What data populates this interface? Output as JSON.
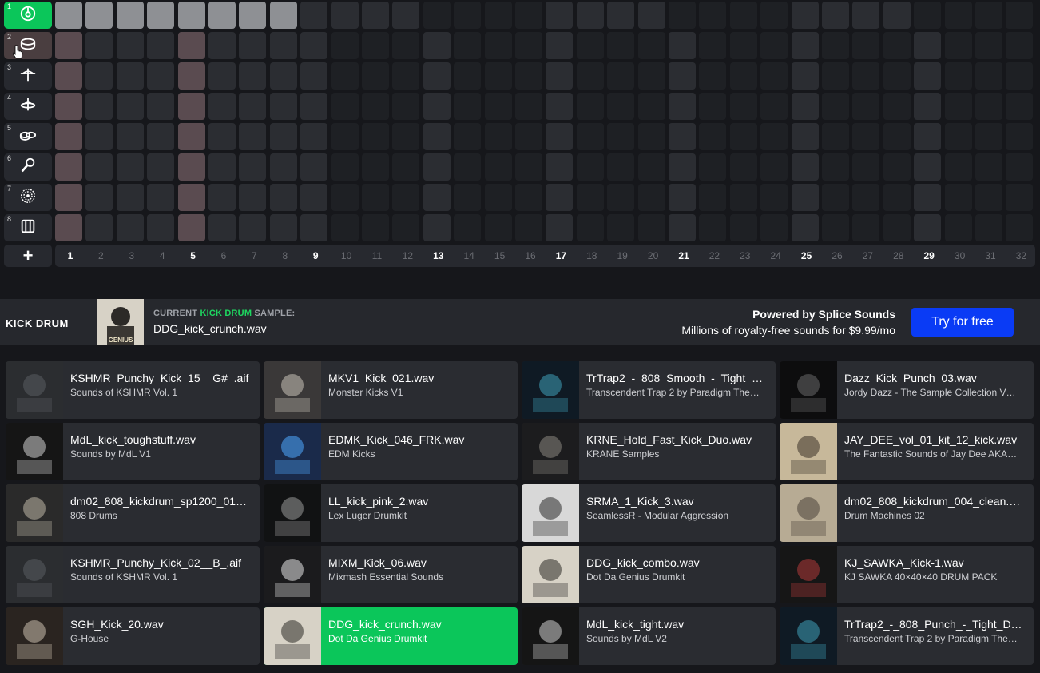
{
  "sequencer": {
    "rows": [
      {
        "num": "1",
        "icon": "kick-drum-icon"
      },
      {
        "num": "2",
        "icon": "snare-drum-icon"
      },
      {
        "num": "3",
        "icon": "hihat-closed-icon"
      },
      {
        "num": "4",
        "icon": "hihat-open-icon"
      },
      {
        "num": "5",
        "icon": "tom-icon"
      },
      {
        "num": "6",
        "icon": "shaker-icon"
      },
      {
        "num": "7",
        "icon": "ride-cymbal-icon"
      },
      {
        "num": "8",
        "icon": "clap-icon"
      }
    ],
    "add_row_label": "+",
    "steps": [
      "1",
      "2",
      "3",
      "4",
      "5",
      "6",
      "7",
      "8",
      "9",
      "10",
      "11",
      "12",
      "13",
      "14",
      "15",
      "16",
      "17",
      "18",
      "19",
      "20",
      "21",
      "22",
      "23",
      "24",
      "25",
      "26",
      "27",
      "28",
      "29",
      "30",
      "31",
      "32"
    ],
    "active_row": 1,
    "hover_row": 2,
    "lit_steps_row1": [
      1,
      2,
      3,
      4,
      5,
      6,
      7,
      8
    ]
  },
  "sample_header": {
    "instrument": "KICK DRUM",
    "label_prefix": "CURRENT ",
    "label_highlight": "KICK DRUM",
    "label_suffix": " SAMPLE:",
    "current_file": "DDG_kick_crunch.wav",
    "splice_title": "Powered by Splice Sounds",
    "splice_sub": "Millions of royalty-free sounds for $9.99/mo",
    "cta_label": "Try for free"
  },
  "samples": [
    {
      "file": "KSHMR_Punchy_Kick_15__G#_.aif",
      "pack": "Sounds of KSHMR Vol. 1",
      "color": "#2b2d30",
      "accent": "#5a5d62"
    },
    {
      "file": "MKV1_Kick_021.wav",
      "pack": "Monster Kicks V1",
      "color": "#3a3838",
      "accent": "#c9c2b8"
    },
    {
      "file": "TrTrap2_-_808_Smooth_-_Tight_…",
      "pack": "Transcendent Trap 2 by Paradigm The…",
      "color": "#0f1a24",
      "accent": "#3fa0b8"
    },
    {
      "file": "Dazz_Kick_Punch_03.wav",
      "pack": "Jordy Dazz - The Sample Collection V…",
      "color": "#0d0d0e",
      "accent": "#6a6a6a"
    },
    {
      "file": "MdL_kick_toughstuff.wav",
      "pack": "Sounds by MdL V1",
      "color": "#151515",
      "accent": "#d0d0d0"
    },
    {
      "file": "EDMK_Kick_046_FRK.wav",
      "pack": "EDM Kicks",
      "color": "#1a2a4a",
      "accent": "#4fa8ff"
    },
    {
      "file": "KRNE_Hold_Fast_Kick_Duo.wav",
      "pack": "KRANE Samples",
      "color": "#1c1c1e",
      "accent": "#8a8680"
    },
    {
      "file": "JAY_DEE_vol_01_kit_12_kick.wav",
      "pack": "The Fantastic Sounds of Jay Dee AKA…",
      "color": "#c7b89a",
      "accent": "#3a3128"
    },
    {
      "file": "dm02_808_kickdrum_sp1200_01…",
      "pack": "808 Drums",
      "color": "#2a2a2a",
      "accent": "#bdb6a6"
    },
    {
      "file": "LL_kick_pink_2.wav",
      "pack": "Lex Luger Drumkit",
      "color": "#111213",
      "accent": "#9a9a9a"
    },
    {
      "file": "SRMA_1_Kick_3.wav",
      "pack": "SeamlessR - Modular Aggression",
      "color": "#d8d8d8",
      "accent": "#2a2a2a"
    },
    {
      "file": "dm02_808_kickdrum_004_clean.…",
      "pack": "Drum Machines 02",
      "color": "#b7ab94",
      "accent": "#4b4238"
    },
    {
      "file": "KSHMR_Punchy_Kick_02__B_.aif",
      "pack": "Sounds of KSHMR Vol. 1",
      "color": "#2b2d30",
      "accent": "#5a5d62"
    },
    {
      "file": "MIXM_Kick_06.wav",
      "pack": "Mixmash Essential Sounds",
      "color": "#1b1b1d",
      "accent": "#e6e6e6"
    },
    {
      "file": "DDG_kick_combo.wav",
      "pack": "Dot Da Genius Drumkit",
      "color": "#d7d2c6",
      "accent": "#2c2a27"
    },
    {
      "file": "KJ_SAWKA_Kick-1.wav",
      "pack": "KJ SAWKA 40×40×40 DRUM PACK",
      "color": "#161616",
      "accent": "#b23a3a"
    },
    {
      "file": "SGH_Kick_20.wav",
      "pack": "G-House",
      "color": "#2a2420",
      "accent": "#cbbfae"
    },
    {
      "file": "DDG_kick_crunch.wav",
      "pack": "Dot Da Genius Drumkit",
      "color": "#d7d2c6",
      "accent": "#2c2a27",
      "selected": true
    },
    {
      "file": "MdL_kick_tight.wav",
      "pack": "Sounds by MdL V2",
      "color": "#151515",
      "accent": "#d0d0d0"
    },
    {
      "file": "TrTrap2_-_808_Punch_-_Tight_D…",
      "pack": "Transcendent Trap 2 by Paradigm The…",
      "color": "#0f1a24",
      "accent": "#3fa0b8"
    }
  ],
  "cover_texts": {
    "monster_kicks": "MONSTER KICKS",
    "edm_kicks": "EDM KICKS",
    "g_house": "G-HOUSE",
    "genius": "GENIUS"
  }
}
